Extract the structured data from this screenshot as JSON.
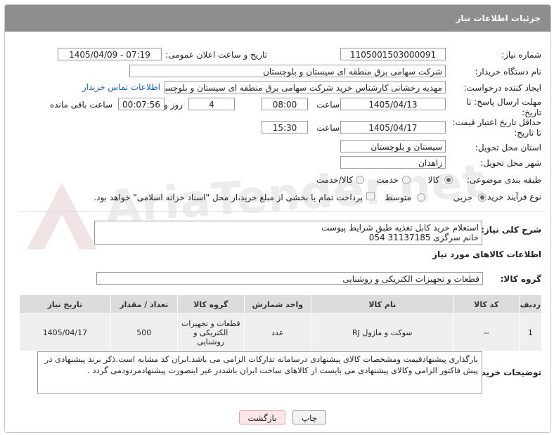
{
  "page": {
    "title": "جزئیات اطلاعات نیاز"
  },
  "watermark": {
    "text": "AriaTender.net"
  },
  "fields": {
    "need_number": {
      "label": "شماره نیاز:",
      "value": "1105001503000091"
    },
    "announce_datetime": {
      "label": "تاریخ و ساعت اعلان عمومی:",
      "value": "1405/04/09 - 07:19"
    },
    "buyer_org": {
      "label": "نام دستگاه خریدار:",
      "value": "شرکت سهامی برق منطقه ای سیستان و بلوچستان"
    },
    "requester": {
      "label": "ایجاد کننده درخواست:",
      "value": "مهدیه رخشانی کارشناس خرید شرکت سهامی برق منطقه ای سیستان و بلوچستان",
      "contact_link": "اطلاعات تماس خریدار"
    },
    "reply_deadline": {
      "label": "مهلت ارسال پاسخ: تا تاریخ:",
      "date": "1405/04/13",
      "time_label": "ساعت",
      "time": "08:00",
      "days": "4",
      "days_label": "روز و",
      "remaining": "00:07:56",
      "remaining_label": "ساعت باقی مانده"
    },
    "price_validity": {
      "label": "حداقل تاریخ اعتبار قیمت: تا تاریخ:",
      "date": "1405/04/17",
      "time_label": "ساعت",
      "time": "15:30"
    },
    "delivery_province": {
      "label": "استان محل تحویل:",
      "value": "سیستان و بلوچستان"
    },
    "delivery_city": {
      "label": "شهر محل تحویل:",
      "value": "زاهدان"
    },
    "category": {
      "label": "طبقه بندی موضوعی:",
      "options": [
        "کالا",
        "خدمت",
        "کالا/خدمت"
      ],
      "selected": "کالا"
    },
    "process_type": {
      "label": "نوع فرآیند خرید :",
      "options": [
        "جزیی",
        "متوسط"
      ],
      "selected": "جزیی",
      "treasury_note": "پرداخت تمام یا بخشی از مبلغ خرید،از محل \"اسناد خزانه اسلامی\" خواهد بود."
    }
  },
  "description": {
    "label": "شرح کلی نیاز:",
    "line1": "استعلام خرید کابل تغذیه طبق شرایط پیوست",
    "line2": "خانم سرگزی 31137185 054"
  },
  "goods_info": {
    "section_title": "اطلاعات کالاهای مورد نیاز",
    "group_label": "گروه کالا:",
    "group_value": "قطعات و تجهیزات الکتریکی و روشنایی",
    "columns": [
      "ردیف",
      "کد کالا",
      "نام کالا",
      "واحد شمارش",
      "گروه کالا",
      "تعداد / مقدار",
      "تاریخ نیاز"
    ],
    "rows": [
      {
        "index": "1",
        "code": "--",
        "name": "سوکت و ماژول RJ",
        "unit": "عدد",
        "group": "قطعات و تجهیزات الکتریکی و روشنایی",
        "qty": "500",
        "date": "1405/04/17"
      }
    ]
  },
  "buyer_notes": {
    "label": "توضیحات خریدار:",
    "text": "بارگذاری پیشنهادقیمت ومشخصات کالای پیشنهادی درسامانه تدارکات الزامی می باشد.ایران کد مشابه است.ذکر برند پیشنهادی در پیش فاکتور الزامی وکالای پیشنهادی می بایست از کالاهای ساخت ایران باشددر غیر اینصورت پیشنهادمردودمی گردد ."
  },
  "buttons": {
    "print": "چاپ",
    "back": "بازگشت"
  }
}
